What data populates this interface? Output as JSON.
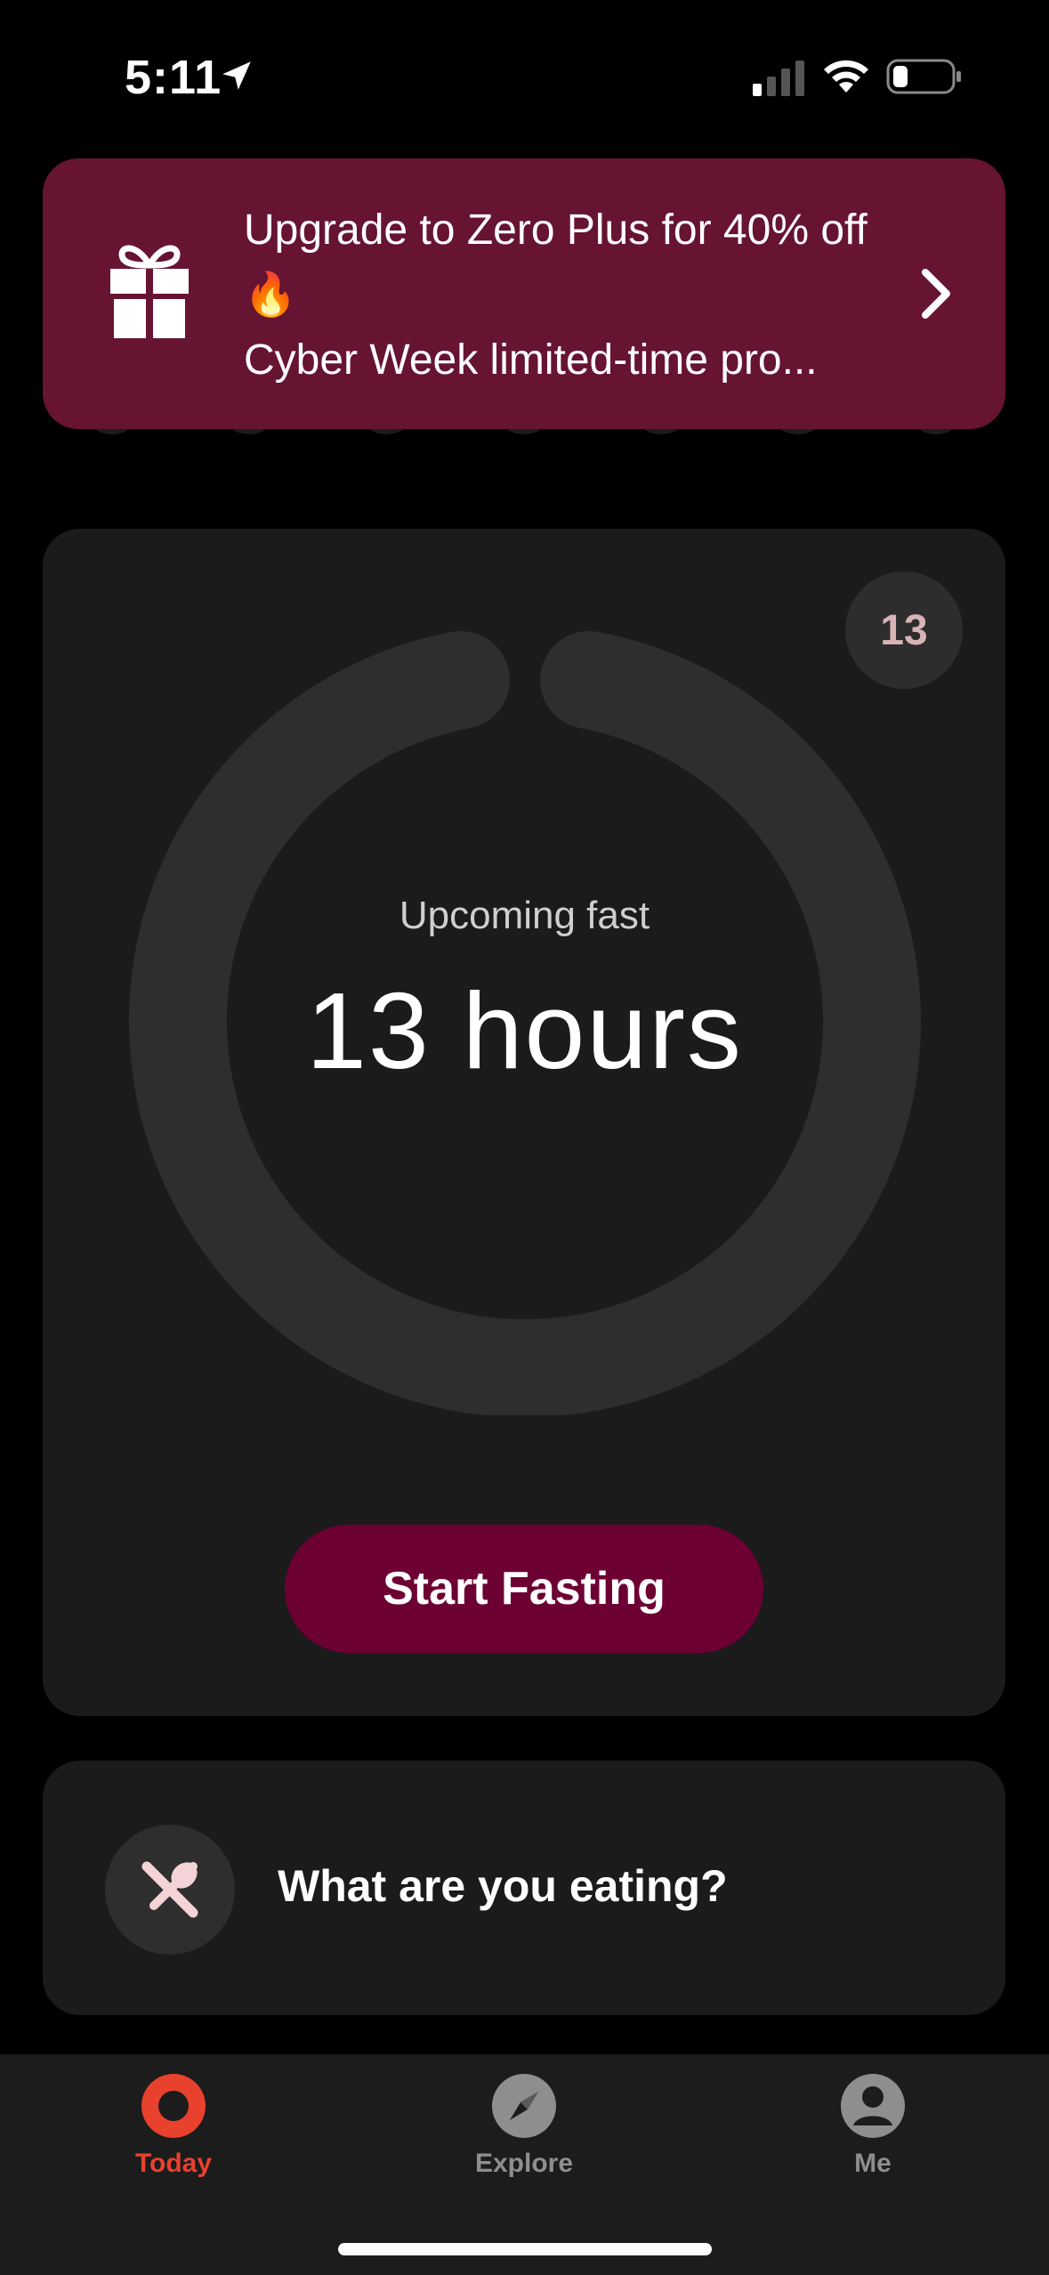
{
  "status": {
    "time": "5:11"
  },
  "promo": {
    "title": "Upgrade to Zero Plus for 40% off 🔥",
    "subtitle": "Cyber Week limited-time pro..."
  },
  "fast": {
    "day_badge": "13",
    "label": "Upcoming fast",
    "value": "13 hours",
    "button": "Start Fasting"
  },
  "eating": {
    "label": "What are you eating?"
  },
  "tabs": [
    {
      "label": "Today",
      "icon": "ring-icon",
      "active": true
    },
    {
      "label": "Explore",
      "icon": "compass-icon",
      "active": false
    },
    {
      "label": "Me",
      "icon": "person-icon",
      "active": false
    }
  ],
  "colors": {
    "promo_bg": "#661432",
    "button_bg": "#6d0033",
    "accent": "#e8412e",
    "inactive": "#8e8e8e"
  }
}
